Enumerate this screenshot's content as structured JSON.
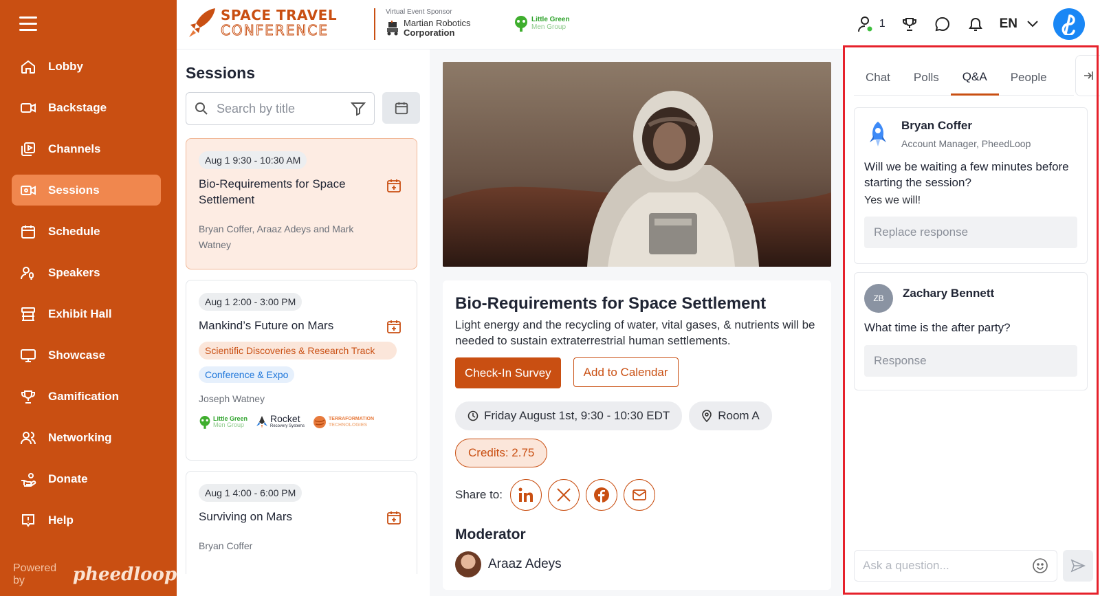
{
  "sidebar": {
    "items": [
      {
        "label": "Lobby",
        "icon": "home-icon"
      },
      {
        "label": "Backstage",
        "icon": "video-camera-icon"
      },
      {
        "label": "Channels",
        "icon": "channels-icon"
      },
      {
        "label": "Sessions",
        "icon": "sessions-icon",
        "active": true
      },
      {
        "label": "Schedule",
        "icon": "calendar-icon"
      },
      {
        "label": "Speakers",
        "icon": "speaker-icon"
      },
      {
        "label": "Exhibit Hall",
        "icon": "booth-icon"
      },
      {
        "label": "Showcase",
        "icon": "monitor-icon"
      },
      {
        "label": "Gamification",
        "icon": "trophy-icon"
      },
      {
        "label": "Networking",
        "icon": "people-icon"
      },
      {
        "label": "Donate",
        "icon": "donate-icon"
      },
      {
        "label": "Help",
        "icon": "help-icon"
      }
    ],
    "powered_by": "Powered by",
    "powered_logo": "pheedloop"
  },
  "header": {
    "brand_line1": "SPACE TRAVEL",
    "brand_line2": "CONFERENCE",
    "sponsor_label": "Virtual Event Sponsor",
    "sponsor_name_line1": "Martian Robotics",
    "sponsor_name_line2": "Corporation",
    "partner_line1": "Little Green",
    "partner_line2": "Men Group",
    "attendee_count": "1",
    "language": "EN"
  },
  "sessions": {
    "title": "Sessions",
    "search_placeholder": "Search by title",
    "cards": [
      {
        "time": "Aug 1 9:30 - 10:30 AM",
        "title": "Bio-Requirements for Space Settlement",
        "people": "Bryan Coffer, Araaz Adeys and Mark Watney"
      },
      {
        "time": "Aug 1 2:00 - 3:00 PM",
        "title": "Mankind’s Future on Mars",
        "tag_track": "Scientific Discoveries & Research Track",
        "tag_type": "Conference & Expo",
        "people": "Joseph Watney",
        "logo1_l1": "Little Green",
        "logo1_l2": "Men Group",
        "logo2_l1": "Rocket",
        "logo2_l2": "Recovery Systems",
        "logo3_l1": "TERRAFORMATION",
        "logo3_l2": "TECHNOLOGIES"
      },
      {
        "time": "Aug 1 4:00 - 6:00 PM",
        "title": "Surviving on Mars",
        "people": "Bryan Coffer"
      }
    ]
  },
  "detail": {
    "title": "Bio-Requirements for Space Settlement",
    "description": "Light energy and the recycling of water, vital gases, & nutrients will be needed to sustain extraterrestrial human settlements.",
    "checkin_label": "Check-In Survey",
    "calendar_label": "Add to Calendar",
    "datetime": "Friday August 1st, 9:30 - 10:30 EDT",
    "room": "Room A",
    "credits": "Credits: 2.75",
    "share_label": "Share to:",
    "moderator_heading": "Moderator",
    "moderator_name": "Araaz Adeys"
  },
  "panel": {
    "tabs": [
      "Chat",
      "Polls",
      "Q&A",
      "People"
    ],
    "active_tab": "Q&A",
    "questions": [
      {
        "name": "Bryan Coffer",
        "role": "Account Manager, PheedLoop",
        "question": "Will we be waiting a few minutes before starting the session?",
        "answer": "Yes we will!",
        "response_placeholder": "Replace response"
      },
      {
        "name": "Zachary Bennett",
        "initials": "ZB",
        "question": "What time is the after party?",
        "response_placeholder": "Response"
      }
    ],
    "ask_placeholder": "Ask a question..."
  },
  "colors": {
    "brand": "#c94f12",
    "brand_light": "#f0874e",
    "highlight": "#e6212b",
    "avatar_blue": "#1a87f5"
  }
}
